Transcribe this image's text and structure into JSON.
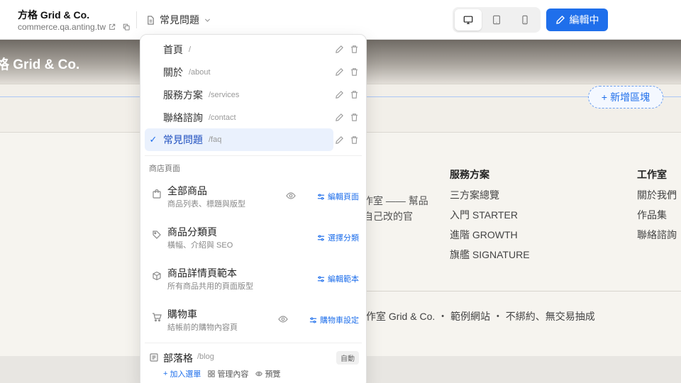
{
  "site": {
    "name": "方格 Grid & Co.",
    "url": "commerce.qa.anting.tw"
  },
  "page_selector": {
    "label": "常見問題"
  },
  "device_modes": [
    "desktop",
    "tablet",
    "mobile"
  ],
  "edit_button": {
    "label": "編輯中"
  },
  "preview": {
    "hero_title": "格 Grid & Co.",
    "add_block": "新增區塊",
    "intro_lines": [
      "作室 —— 幫品",
      "自己改的官"
    ],
    "columns": [
      {
        "heading": "服務方案",
        "links": [
          "三方案總覽",
          "入門 STARTER",
          "進階 GROWTH",
          "旗艦 SIGNATURE"
        ]
      },
      {
        "heading": "工作室",
        "links": [
          "關於我們",
          "作品集",
          "聯絡諮詢"
        ]
      }
    ],
    "copyright": "作室 Grid & Co. ・ 範例網站 ・ 不綁約、無交易抽成"
  },
  "pages": [
    {
      "name": "首頁",
      "path": "/"
    },
    {
      "name": "關於",
      "path": "/about"
    },
    {
      "name": "服務方案",
      "path": "/services"
    },
    {
      "name": "聯絡諮詢",
      "path": "/contact"
    },
    {
      "name": "常見問題",
      "path": "/faq",
      "selected": true
    }
  ],
  "shop_section": {
    "label": "商店頁面",
    "items": [
      {
        "title": "全部商品",
        "desc": "商品列表、標題與版型",
        "action": "編輯頁面",
        "icon": "shopping-bag-icon",
        "has_eye": true
      },
      {
        "title": "商品分類頁",
        "desc": "橫幅、介紹與 SEO",
        "action": "選擇分類",
        "icon": "tag-icon",
        "has_eye": false
      },
      {
        "title": "商品詳情頁範本",
        "desc": "所有商品共用的頁面版型",
        "action": "編輯範本",
        "icon": "package-search-icon",
        "has_eye": false
      },
      {
        "title": "購物車",
        "desc": "結帳前的購物內容頁",
        "action": "購物車設定",
        "icon": "cart-icon",
        "has_eye": true
      }
    ]
  },
  "blog": {
    "title": "部落格",
    "path": "/blog",
    "badge": "自動",
    "actions": {
      "add": "加入選單",
      "manage": "管理內容",
      "preview": "預覽"
    }
  },
  "colors": {
    "accent": "#1f6feb",
    "selected_bg": "#eaf1fd"
  }
}
